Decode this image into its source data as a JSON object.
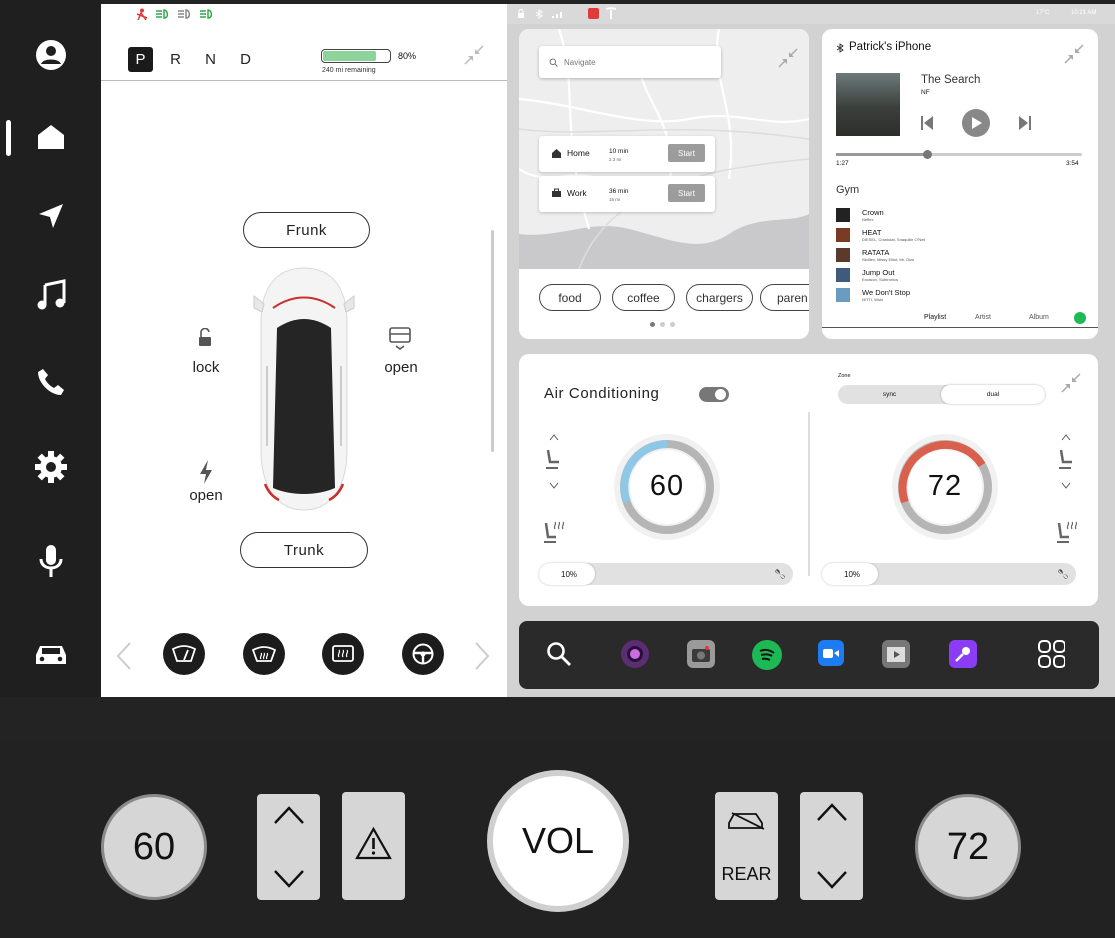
{
  "status_left": {
    "icons": [
      "seatbelt-warning-icon",
      "headlight-icon",
      "fog-light-icon",
      "parking-light-icon"
    ]
  },
  "status_right": {
    "temp": "17°C",
    "time": "10:21 AM"
  },
  "gear": {
    "items": [
      "P",
      "R",
      "N",
      "D"
    ],
    "selected": "P"
  },
  "battery": {
    "percent_label": "80%",
    "level": 0.8,
    "range": "240 mi remaining"
  },
  "car": {
    "frunk": "Frunk",
    "trunk": "Trunk",
    "lock": "lock",
    "right_open": "open",
    "charge_open": "open"
  },
  "quick_controls": [
    "wiper-icon",
    "front-defrost-icon",
    "rear-defrost-icon",
    "steering-wheel-heat-icon"
  ],
  "nav": {
    "search_placeholder": "Navigate",
    "destinations": [
      {
        "name": "Home",
        "time": "10 min",
        "distance": "2.3 mi",
        "action": "Start"
      },
      {
        "name": "Work",
        "time": "36 min",
        "distance": "15 mi",
        "action": "Start"
      }
    ],
    "chips": [
      "food",
      "coffee",
      "chargers",
      "paren"
    ]
  },
  "media": {
    "device": "Patrick's iPhone",
    "track": "The Search",
    "artist": "NF",
    "elapsed": "1:27",
    "duration": "3:54",
    "progress": 0.37,
    "playlist": "Gym",
    "songs": [
      {
        "title": "Crown",
        "artist": "Neffex"
      },
      {
        "title": "HEAT",
        "artist": "DIESEL, Crankdat, Snaquille O'Neil"
      },
      {
        "title": "RATATA",
        "artist": "Skrillex, Missy Elliot, Mr. Oizo"
      },
      {
        "title": "Jump Out",
        "artist": "Excision, Subtronics"
      },
      {
        "title": "We Don't Stop",
        "artist": "NITTI, Wuki"
      }
    ],
    "tabs": [
      "Playlist",
      "Artist",
      "Album"
    ],
    "active_tab": "Playlist"
  },
  "climate": {
    "title": "Air Conditioning",
    "zone_label": "Zone",
    "zone_options": [
      "sync",
      "dual"
    ],
    "zone_selected": "dual",
    "left_temp": "60",
    "right_temp": "72",
    "left_fan": "10%",
    "right_fan": "10%"
  },
  "dock": {
    "apps": [
      "search-icon",
      "camera-lens-icon",
      "camera-icon",
      "spotify-icon",
      "zoom-icon",
      "video-icon",
      "microphone-icon",
      "apps-grid-icon"
    ]
  },
  "hardware": {
    "left_temp": "60",
    "right_temp": "72",
    "volume": "VOL",
    "rear": "REAR"
  },
  "colors": {
    "accent_cool": "#8fc7e6",
    "accent_warm": "#d9604d",
    "spotify": "#1db954",
    "zoom": "#1e7cf2",
    "mic": "#8a3df5",
    "battery": "#8dd49a"
  }
}
